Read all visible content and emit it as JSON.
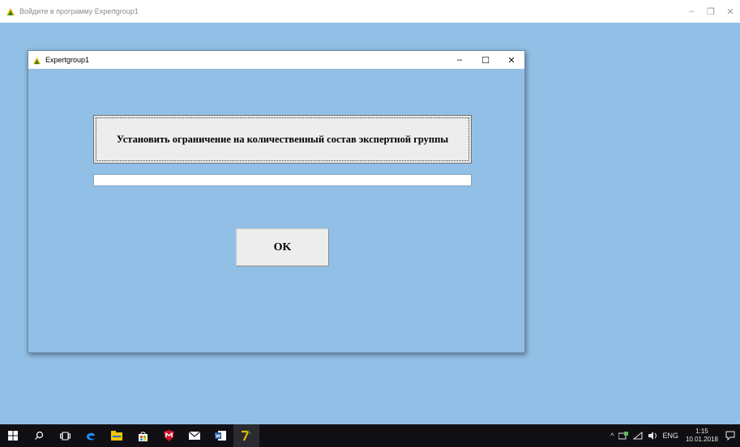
{
  "outer_window": {
    "title": "Войдите в программу Expertgroup1",
    "controls": {
      "minimize": "–",
      "maximize": "❐",
      "close": "✕"
    }
  },
  "dialog": {
    "title": "Expertgroup1",
    "controls": {
      "minimize": "–",
      "maximize": "☐",
      "close": "✕"
    },
    "limit_button_label": "Установить ограничение на количественный состав экспертной группы",
    "limit_input_value": "",
    "ok_label": "OK"
  },
  "taskbar": {
    "pinned_icons": [
      "windows-start-icon",
      "search-icon",
      "task-view-icon",
      "edge-icon",
      "file-explorer-icon",
      "store-icon",
      "mcafee-icon",
      "mail-icon",
      "word-icon",
      "expertgroup-icon"
    ],
    "tray": {
      "chevron": "^",
      "language": "ENG",
      "time": "1:15",
      "date": "10.01.2018"
    }
  },
  "colors": {
    "desktop_background": "#92bfe6",
    "taskbar": "#101014",
    "button_face": "#ededed"
  }
}
